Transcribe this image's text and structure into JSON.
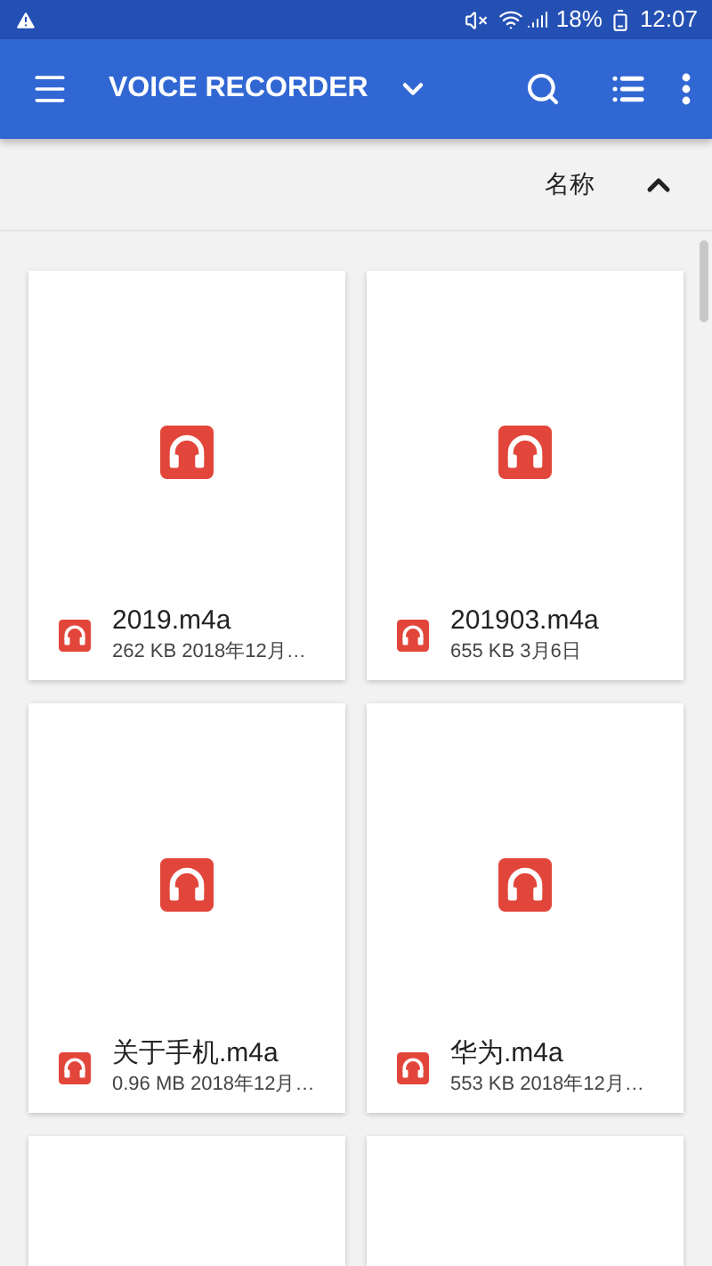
{
  "status_bar": {
    "battery": "18%",
    "time": "12:07"
  },
  "app_bar": {
    "title": "VOICE RECORDER"
  },
  "sort_bar": {
    "label": "名称"
  },
  "files": [
    {
      "kind": "file",
      "name": "2019.m4a",
      "details": "262 KB 2018年12月…"
    },
    {
      "kind": "file",
      "name": "201903.m4a",
      "details": "655 KB 3月6日"
    },
    {
      "kind": "file",
      "name": "关于手机.m4a",
      "details": "0.96 MB 2018年12月…"
    },
    {
      "kind": "file",
      "name": "华为.m4a",
      "details": "553 KB 2018年12月…"
    },
    {
      "kind": "cut_off"
    },
    {
      "kind": "cut_off"
    }
  ]
}
